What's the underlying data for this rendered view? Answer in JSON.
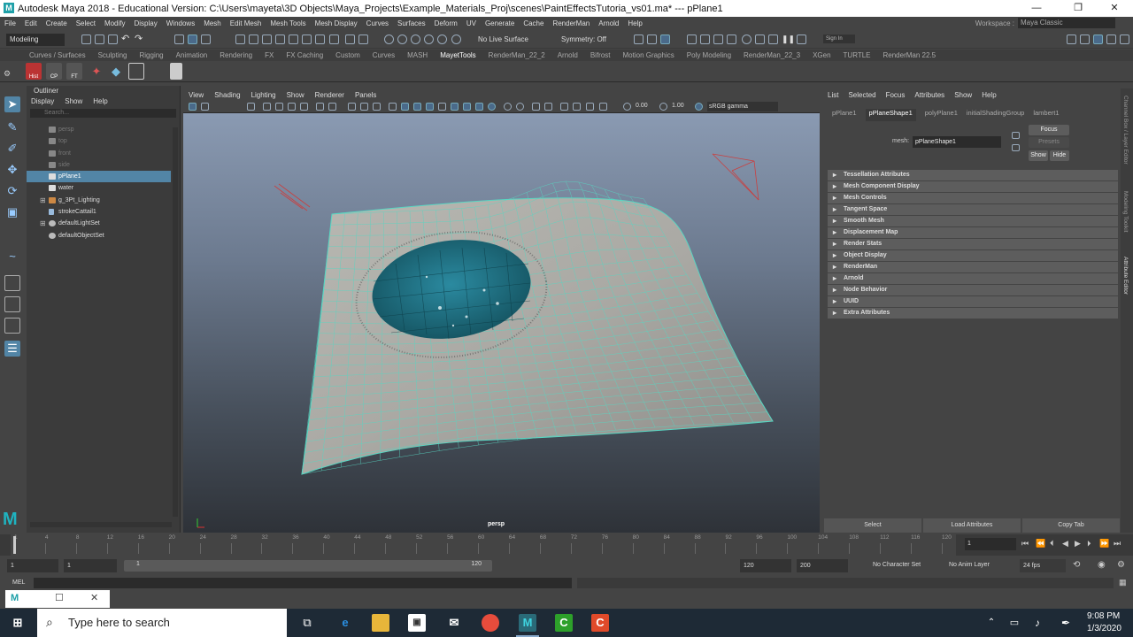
{
  "titlebar": {
    "app_icon": "maya-logo-icon",
    "title": "Autodesk Maya 2018 - Educational Version: C:\\Users\\mayeta\\3D Objects\\Maya_Projects\\Example_Materials_Proj\\scenes\\PaintEffectsTutoria_vs01.ma*   ---   pPlane1"
  },
  "menubar": {
    "items": [
      "File",
      "Edit",
      "Create",
      "Select",
      "Modify",
      "Display",
      "Windows",
      "Mesh",
      "Edit Mesh",
      "Mesh Tools",
      "Mesh Display",
      "Curves",
      "Surfaces",
      "Deform",
      "UV",
      "Generate",
      "Cache",
      "RenderMan",
      "Arnold",
      "Help"
    ],
    "workspace_label": "Workspace :",
    "workspace_value": "Maya Classic"
  },
  "statusline": {
    "mode": "Modeling",
    "live_surface": "No Live Surface",
    "symmetry": "Symmetry: Off",
    "signin": "Sign In"
  },
  "shelf": {
    "tabs": [
      "Curves / Surfaces",
      "Sculpting",
      "Rigging",
      "Animation",
      "Rendering",
      "FX",
      "FX Caching",
      "Custom",
      "Curves",
      "MASH",
      "MayetTools",
      "RenderMan_22_2",
      "Arnold",
      "Bifrost",
      "Motion Graphics",
      "Poly Modeling",
      "RenderMan_22_3",
      "XGen",
      "TURTLE",
      "RenderMan 22.5"
    ],
    "active_tab": "MayetTools",
    "buttons": [
      "Hist",
      "CP",
      "FT"
    ]
  },
  "outliner": {
    "title": "Outliner",
    "menu": [
      "Display",
      "Show",
      "Help"
    ],
    "search_placeholder": "Search...",
    "items": [
      {
        "label": "persp",
        "dim": true
      },
      {
        "label": "top",
        "dim": true
      },
      {
        "label": "front",
        "dim": true
      },
      {
        "label": "side",
        "dim": true
      },
      {
        "label": "pPlane1",
        "selected": true
      },
      {
        "label": "water"
      },
      {
        "label": "g_3Pt_Lighting",
        "expandable": true
      },
      {
        "label": "strokeCattail1"
      },
      {
        "label": "defaultLightSet",
        "expandable": true
      },
      {
        "label": "defaultObjectSet"
      }
    ]
  },
  "viewport": {
    "menu": [
      "View",
      "Shading",
      "Lighting",
      "Show",
      "Renderer",
      "Panels"
    ],
    "exposure": "0.00",
    "gamma": "1.00",
    "colorspace": "sRGB gamma",
    "camera_label": "persp"
  },
  "attribute_editor": {
    "menu": [
      "List",
      "Selected",
      "Focus",
      "Attributes",
      "Show",
      "Help"
    ],
    "tabs": [
      "pPlane1",
      "pPlaneShape1",
      "polyPlane1",
      "initialShadingGroup",
      "lambert1"
    ],
    "active_tab": "pPlaneShape1",
    "mesh_label": "mesh:",
    "mesh_value": "pPlaneShape1",
    "focus_btn": "Focus",
    "presets_btn": "Presets",
    "show_btn": "Show",
    "hide_btn": "Hide",
    "sections": [
      "Tessellation Attributes",
      "Mesh Component Display",
      "Mesh Controls",
      "Tangent Space",
      "Smooth Mesh",
      "Displacement Map",
      "Render Stats",
      "Object Display",
      "RenderMan",
      "Arnold",
      "Node Behavior",
      "UUID",
      "Extra Attributes"
    ],
    "footer": [
      "Select",
      "Load Attributes",
      "Copy Tab"
    ]
  },
  "side_tabs": [
    "Channel Box / Layer Editor",
    "Modeling Toolkit",
    "Attribute Editor"
  ],
  "timeline": {
    "ticks": [
      "1",
      "4",
      "8",
      "12",
      "16",
      "20",
      "24",
      "28",
      "32",
      "36",
      "40",
      "44",
      "48",
      "52",
      "56",
      "60",
      "64",
      "68",
      "72",
      "76",
      "80",
      "84",
      "88",
      "92",
      "96",
      "100",
      "104",
      "108",
      "112",
      "116",
      "120"
    ],
    "current_frame": "1"
  },
  "range": {
    "start": "1",
    "inner_start": "1",
    "slider_start": "1",
    "slider_end": "120",
    "end": "120",
    "anim_end": "200",
    "character_set": "No Character Set",
    "anim_layer": "No Anim Layer",
    "fps": "24 fps"
  },
  "cmdline": {
    "label": "MEL"
  },
  "taskbar": {
    "search_placeholder": "Type here to search",
    "time": "9:08 PM",
    "date": "1/3/2020"
  },
  "colors": {
    "selection": "#5285a6",
    "wire": "#58d6c2",
    "water": "#1f6f80"
  }
}
